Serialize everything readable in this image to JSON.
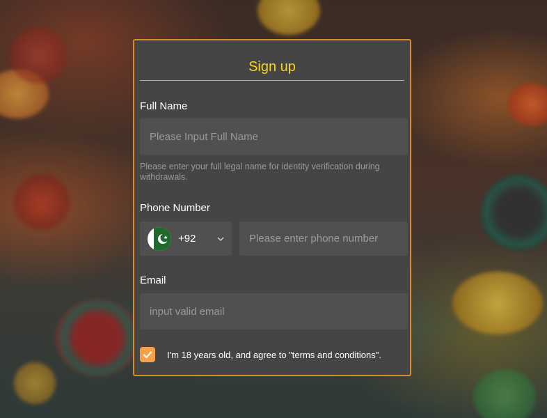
{
  "modal": {
    "title": "Sign up"
  },
  "full_name": {
    "label": "Full Name",
    "placeholder": "Please Input Full Name",
    "value": "",
    "hint": "Please enter your full legal name for identity verification during withdrawals."
  },
  "phone": {
    "label": "Phone Number",
    "country_code": "+92",
    "country_flag": "pakistan-flag-icon",
    "placeholder": "Please enter phone number",
    "value": ""
  },
  "email": {
    "label": "Email",
    "placeholder": "input valid email",
    "value": ""
  },
  "agreement": {
    "checked": true,
    "text": "I'm 18 years old, and agree to \"terms and conditions\"."
  },
  "colors": {
    "accent": "#f6d51c",
    "border": "#d98a2b",
    "checkbox": "#f5a04a",
    "panel": "#454545",
    "input_bg": "#505050"
  }
}
